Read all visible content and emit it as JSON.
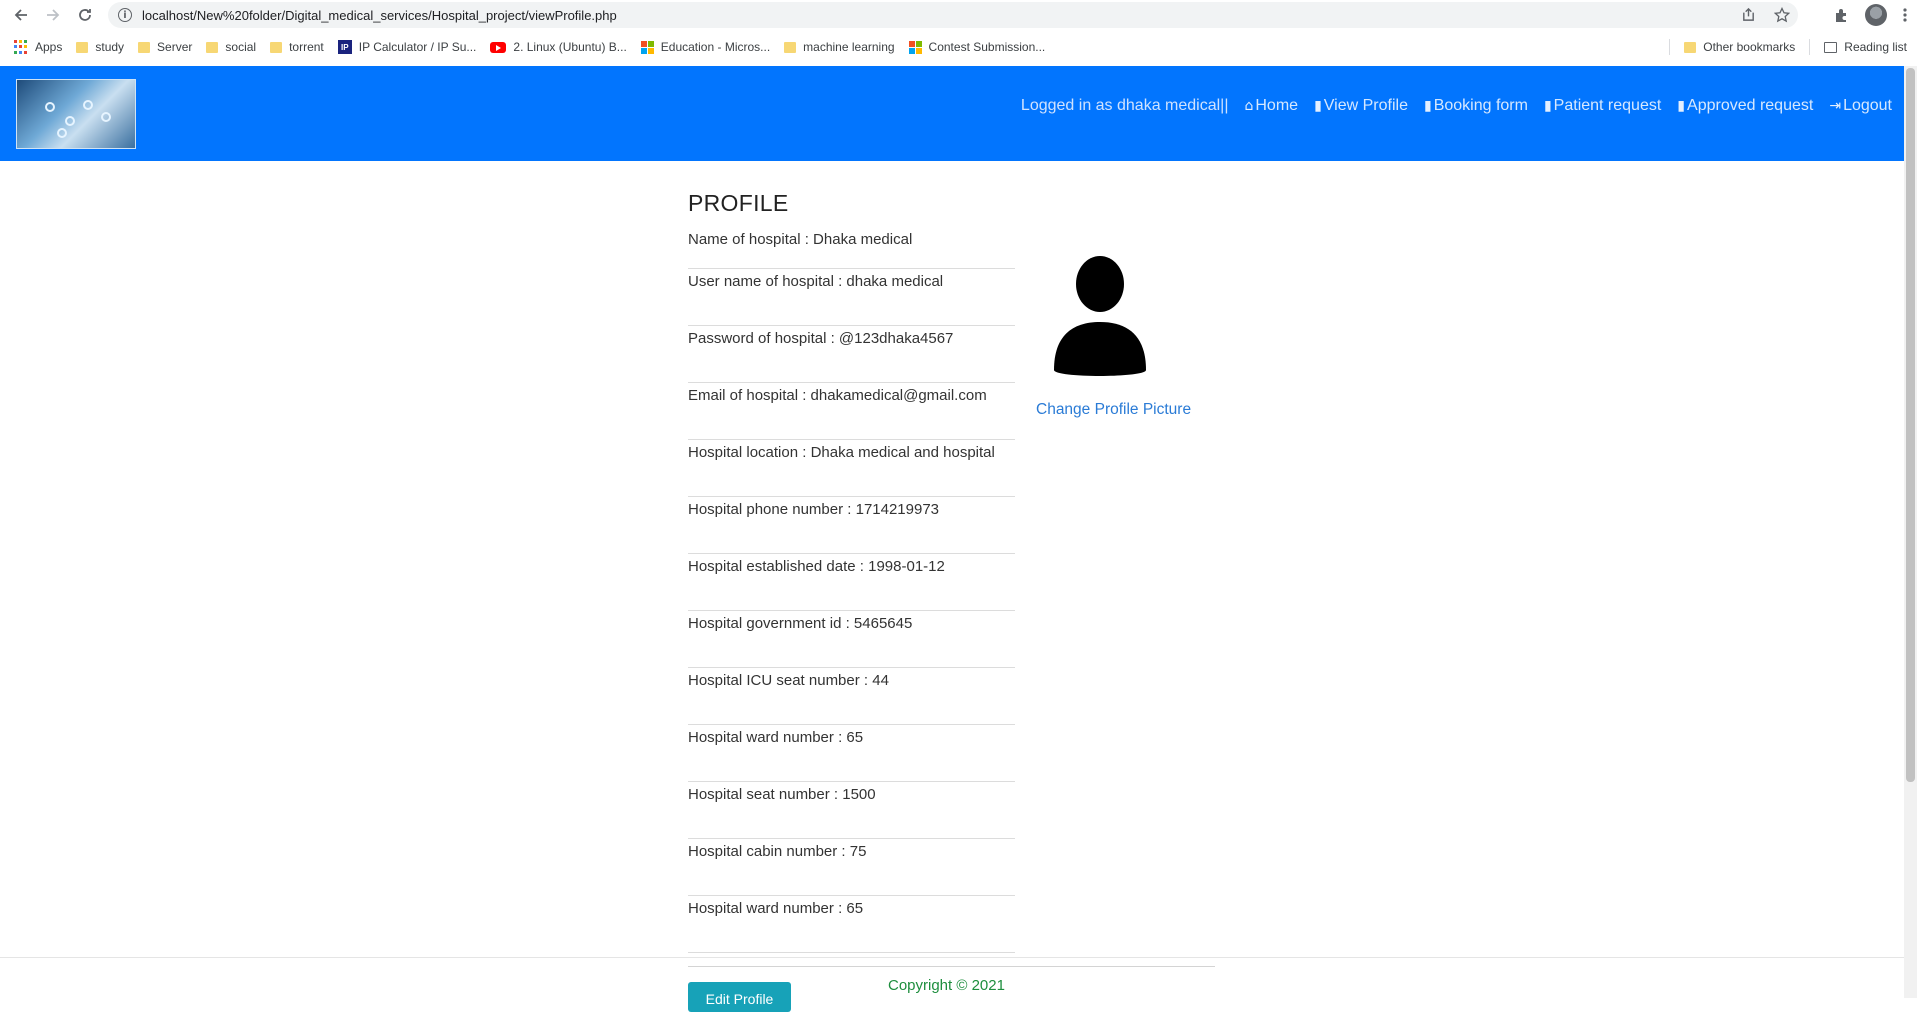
{
  "browser": {
    "url": "localhost/New%20folder/Digital_medical_services/Hospital_project/viewProfile.php",
    "bookmarks": [
      "Apps",
      "study",
      "Server",
      "social",
      "torrent",
      "IP Calculator / IP Su...",
      "2. Linux (Ubuntu) B...",
      "Education - Micros...",
      "machine learning",
      "Contest Submission..."
    ],
    "other_bookmarks": "Other bookmarks",
    "reading_list": "Reading list"
  },
  "navbar": {
    "logged_in": "Logged in as dhaka medical||",
    "links": [
      "Home",
      "View Profile",
      "Booking form",
      "Patient request",
      "Approved request",
      "Logout"
    ]
  },
  "profile": {
    "title": "PROFILE",
    "fields": [
      "Name of hospital : Dhaka medical",
      "User name of hospital : dhaka medical",
      "Password of hospital : @123dhaka4567",
      "Email of hospital : dhakamedical@gmail.com",
      "Hospital location : Dhaka medical and hospital",
      "Hospital phone number : 1714219973",
      "Hospital established date : 1998-01-12",
      "Hospital government id : 5465645",
      "Hospital ICU seat number : 44",
      "Hospital ward number : 65",
      "Hospital seat number : 1500",
      "Hospital cabin number : 75",
      "Hospital ward number : 65"
    ],
    "change_picture": "Change Profile Picture"
  },
  "footer": {
    "edit_button": "Edit Profile",
    "copyright": "Copyright © 2021"
  },
  "colors": {
    "navbar": "#0275fe",
    "link": "#2a7bd6",
    "button": "#17a2b8",
    "copyright": "#1e8e3e"
  }
}
